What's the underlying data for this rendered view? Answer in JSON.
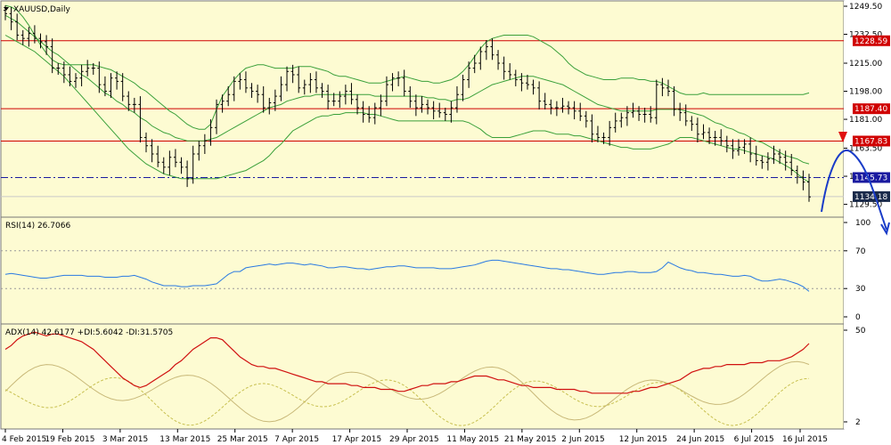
{
  "chart_data": {
    "type": "line",
    "symbol": "XAUUSD,Daily",
    "price_panel": {
      "ylim": [
        1125.5,
        1249.5
      ],
      "y_ticks": [
        1249.5,
        1232.5,
        1215.0,
        1198.0,
        1181.0,
        1163.5,
        1146.5,
        1129.5
      ],
      "y_tick_labels": [
        "1249.50",
        "1232.50",
        "1215.00",
        "1198.00",
        "1181.00",
        "1163.50",
        "1146.50",
        "1129.50"
      ],
      "levels": [
        {
          "value": 1228.59,
          "label": "1228.59",
          "color": "#d00000",
          "style": "solid"
        },
        {
          "value": 1187.4,
          "label": "1187.40",
          "color": "#d00000",
          "style": "solid"
        },
        {
          "value": 1167.83,
          "label": "1167.83",
          "color": "#d00000",
          "style": "solid"
        },
        {
          "value": 1145.73,
          "label": "1145.73",
          "color": "#1a1aa0",
          "style": "dashdot"
        },
        {
          "value": 1134.18,
          "label": "1134.18",
          "color": "#1a2a4a",
          "style": "solid"
        }
      ],
      "close": [
        1245,
        1240,
        1232,
        1230,
        1233,
        1230,
        1228,
        1225,
        1212,
        1212,
        1208,
        1204,
        1206,
        1210,
        1212,
        1212,
        1202,
        1198,
        1206,
        1204,
        1195,
        1190,
        1190,
        1170,
        1165,
        1160,
        1155,
        1152,
        1158,
        1155,
        1152,
        1145,
        1160,
        1165,
        1168,
        1176,
        1190,
        1192,
        1196,
        1204,
        1205,
        1200,
        1198,
        1196,
        1188,
        1191,
        1195,
        1202,
        1210,
        1208,
        1200,
        1202,
        1205,
        1200,
        1198,
        1192,
        1192,
        1195,
        1198,
        1193,
        1188,
        1184,
        1182,
        1188,
        1192,
        1202,
        1206,
        1206,
        1198,
        1192,
        1188,
        1190,
        1188,
        1186,
        1185,
        1184,
        1188,
        1196,
        1205,
        1212,
        1215,
        1222,
        1225,
        1220,
        1215,
        1210,
        1208,
        1205,
        1203,
        1202,
        1200,
        1192,
        1190,
        1188,
        1188,
        1189,
        1188,
        1186,
        1183,
        1180,
        1172,
        1170,
        1170,
        1176,
        1180,
        1182,
        1185,
        1186,
        1184,
        1184,
        1182,
        1202,
        1200,
        1198,
        1187,
        1185,
        1180,
        1178,
        1172,
        1173,
        1170,
        1170,
        1168,
        1165,
        1162,
        1164,
        1166,
        1160,
        1156,
        1155,
        1157,
        1160,
        1158,
        1155,
        1150,
        1146,
        1143,
        1134
      ],
      "bb_upper": [
        1250,
        1249,
        1247,
        1243,
        1238,
        1232,
        1226,
        1221,
        1217,
        1215,
        1214,
        1214,
        1214,
        1214,
        1214,
        1214,
        1213,
        1212,
        1211,
        1209,
        1207,
        1205,
        1203,
        1200,
        1198,
        1195,
        1192,
        1189,
        1186,
        1184,
        1181,
        1178,
        1176,
        1175,
        1175,
        1178,
        1187,
        1195,
        1200,
        1205,
        1209,
        1212,
        1213,
        1214,
        1214,
        1213,
        1212,
        1212,
        1212,
        1212,
        1213,
        1213,
        1213,
        1212,
        1211,
        1210,
        1208,
        1207,
        1207,
        1206,
        1205,
        1204,
        1203,
        1203,
        1203,
        1204,
        1205,
        1206,
        1207,
        1206,
        1205,
        1204,
        1204,
        1203,
        1203,
        1204,
        1205,
        1207,
        1210,
        1214,
        1219,
        1224,
        1228,
        1230,
        1231,
        1232,
        1232,
        1232,
        1232,
        1232,
        1231,
        1229,
        1227,
        1225,
        1222,
        1219,
        1215,
        1212,
        1210,
        1208,
        1207,
        1206,
        1205,
        1205,
        1205,
        1206,
        1206,
        1206,
        1205,
        1205,
        1204,
        1204,
        1203,
        1201,
        1199,
        1197,
        1196,
        1196,
        1196,
        1197,
        1196,
        1196,
        1196,
        1196,
        1196,
        1196,
        1196,
        1196,
        1196,
        1196,
        1196,
        1196,
        1196,
        1196,
        1196,
        1196,
        1196,
        1197
      ],
      "bb_mid": [
        1244,
        1242,
        1240,
        1237,
        1234,
        1231,
        1228,
        1225,
        1222,
        1220,
        1217,
        1214,
        1211,
        1208,
        1206,
        1203,
        1200,
        1197,
        1195,
        1192,
        1190,
        1187,
        1185,
        1182,
        1180,
        1177,
        1175,
        1173,
        1172,
        1170,
        1169,
        1168,
        1168,
        1168,
        1168,
        1169,
        1170,
        1172,
        1174,
        1176,
        1178,
        1180,
        1182,
        1184,
        1186,
        1188,
        1189,
        1190,
        1192,
        1193,
        1194,
        1195,
        1195,
        1196,
        1196,
        1196,
        1196,
        1196,
        1196,
        1196,
        1196,
        1196,
        1196,
        1195,
        1195,
        1195,
        1195,
        1195,
        1195,
        1195,
        1195,
        1195,
        1194,
        1194,
        1193,
        1193,
        1192,
        1193,
        1193,
        1194,
        1196,
        1198,
        1200,
        1202,
        1203,
        1204,
        1205,
        1206,
        1207,
        1207,
        1207,
        1206,
        1205,
        1204,
        1203,
        1202,
        1200,
        1198,
        1196,
        1194,
        1192,
        1190,
        1189,
        1188,
        1187,
        1186,
        1186,
        1186,
        1186,
        1186,
        1186,
        1187,
        1187,
        1187,
        1187,
        1187,
        1186,
        1185,
        1184,
        1183,
        1181,
        1179,
        1178,
        1176,
        1175,
        1173,
        1172,
        1170,
        1168,
        1167,
        1165,
        1163,
        1161,
        1159,
        1158,
        1157,
        1155,
        1154
      ],
      "bb_lower": [
        1232,
        1230,
        1228,
        1226,
        1224,
        1222,
        1219,
        1216,
        1213,
        1210,
        1207,
        1203,
        1199,
        1195,
        1191,
        1187,
        1183,
        1179,
        1175,
        1171,
        1167,
        1163,
        1160,
        1157,
        1154,
        1152,
        1150,
        1148,
        1147,
        1146,
        1145,
        1145,
        1145,
        1145,
        1145,
        1145,
        1145,
        1146,
        1147,
        1148,
        1149,
        1150,
        1152,
        1154,
        1156,
        1159,
        1163,
        1166,
        1170,
        1174,
        1176,
        1178,
        1180,
        1182,
        1183,
        1183,
        1184,
        1184,
        1185,
        1185,
        1185,
        1185,
        1184,
        1184,
        1183,
        1182,
        1181,
        1180,
        1180,
        1180,
        1180,
        1180,
        1180,
        1180,
        1180,
        1180,
        1180,
        1180,
        1180,
        1179,
        1177,
        1175,
        1172,
        1170,
        1170,
        1170,
        1170,
        1171,
        1172,
        1173,
        1174,
        1174,
        1174,
        1173,
        1172,
        1172,
        1172,
        1171,
        1171,
        1170,
        1169,
        1168,
        1167,
        1166,
        1165,
        1164,
        1164,
        1163,
        1163,
        1163,
        1163,
        1164,
        1165,
        1166,
        1168,
        1170,
        1170,
        1170,
        1169,
        1168,
        1167,
        1166,
        1165,
        1164,
        1163,
        1163,
        1162,
        1161,
        1160,
        1159,
        1158,
        1157,
        1155,
        1153,
        1151,
        1148,
        1145,
        1143
      ],
      "color_candles": "#000000",
      "color_bands": "#3aa03a"
    },
    "rsi_panel": {
      "label": "RSI(14) 26.7066",
      "ylim": [
        0,
        100
      ],
      "y_ticks": [
        100,
        70,
        30,
        0
      ],
      "y_tick_labels": [
        "100",
        "70",
        "30",
        "0"
      ],
      "color": "#2a7ae2",
      "values": [
        45,
        46,
        45,
        44,
        43,
        42,
        41,
        41,
        42,
        43,
        44,
        44,
        44,
        44,
        43,
        43,
        43,
        42,
        42,
        42,
        43,
        43,
        44,
        42,
        40,
        37,
        35,
        33,
        33,
        33,
        32,
        32,
        33,
        33,
        33,
        34,
        35,
        40,
        45,
        48,
        48,
        52,
        53,
        54,
        55,
        56,
        55,
        56,
        57,
        57,
        56,
        55,
        56,
        55,
        54,
        52,
        52,
        53,
        53,
        52,
        51,
        51,
        50,
        51,
        52,
        53,
        53,
        54,
        54,
        53,
        52,
        52,
        52,
        52,
        51,
        51,
        51,
        52,
        53,
        54,
        55,
        57,
        59,
        60,
        60,
        59,
        58,
        57,
        56,
        55,
        54,
        53,
        52,
        51,
        51,
        50,
        50,
        49,
        48,
        47,
        46,
        45,
        45,
        46,
        47,
        47,
        48,
        48,
        47,
        47,
        47,
        48,
        52,
        58,
        55,
        52,
        50,
        49,
        47,
        47,
        46,
        45,
        45,
        44,
        43,
        43,
        44,
        43,
        40,
        38,
        38,
        39,
        40,
        39,
        37,
        35,
        32,
        27
      ]
    },
    "adx_panel": {
      "label": "ADX(14) 42.6177 +DI:5.6042 -DI:31.5705",
      "ylim": [
        2,
        50
      ],
      "y_ticks": [
        50,
        2
      ],
      "y_tick_labels": [
        "50",
        "2"
      ],
      "adx_color": "#d01010",
      "plus_di_color": "#c8b878",
      "minus_di_color": "#c8c050",
      "adx": [
        40,
        42,
        45,
        47,
        48,
        49,
        48,
        47,
        48,
        48,
        47,
        46,
        45,
        44,
        42,
        40,
        37,
        34,
        31,
        28,
        25,
        23,
        21,
        20,
        21,
        23,
        25,
        27,
        29,
        32,
        34,
        37,
        40,
        42,
        44,
        46,
        46,
        45,
        42,
        39,
        36,
        34,
        32,
        31,
        31,
        30,
        30,
        29,
        28,
        27,
        26,
        25,
        24,
        23,
        23,
        22,
        22,
        22,
        22,
        21,
        21,
        20,
        20,
        20,
        19,
        19,
        19,
        18,
        18,
        19,
        20,
        21,
        21,
        22,
        22,
        22,
        23,
        23,
        24,
        25,
        26,
        26,
        26,
        25,
        24,
        24,
        23,
        22,
        21,
        21,
        20,
        20,
        20,
        20,
        19,
        19,
        19,
        19,
        18,
        18,
        17,
        17,
        17,
        17,
        17,
        17,
        17,
        18,
        18,
        19,
        20,
        20,
        21,
        22,
        23,
        24,
        26,
        28,
        29,
        30,
        30,
        31,
        31,
        32,
        32,
        32,
        32,
        33,
        33,
        33,
        34,
        34,
        34,
        35,
        36,
        38,
        40,
        43
      ]
    },
    "x_tick_labels": [
      "4 Feb 2015",
      "19 Feb 2015",
      "3 Mar 2015",
      "13 Mar 2015",
      "25 Mar 2015",
      "7 Apr 2015",
      "17 Apr 2015",
      "29 Apr 2015",
      "11 May 2015",
      "21 May 2015",
      "2 Jun 2015",
      "12 Jun 2015",
      "24 Jun 2015",
      "6 Jul 2015",
      "16 Jul 2015"
    ],
    "annotations": {
      "arrow_down_color": "#e01010",
      "forecast_curve_color": "#1a3cc8"
    }
  }
}
